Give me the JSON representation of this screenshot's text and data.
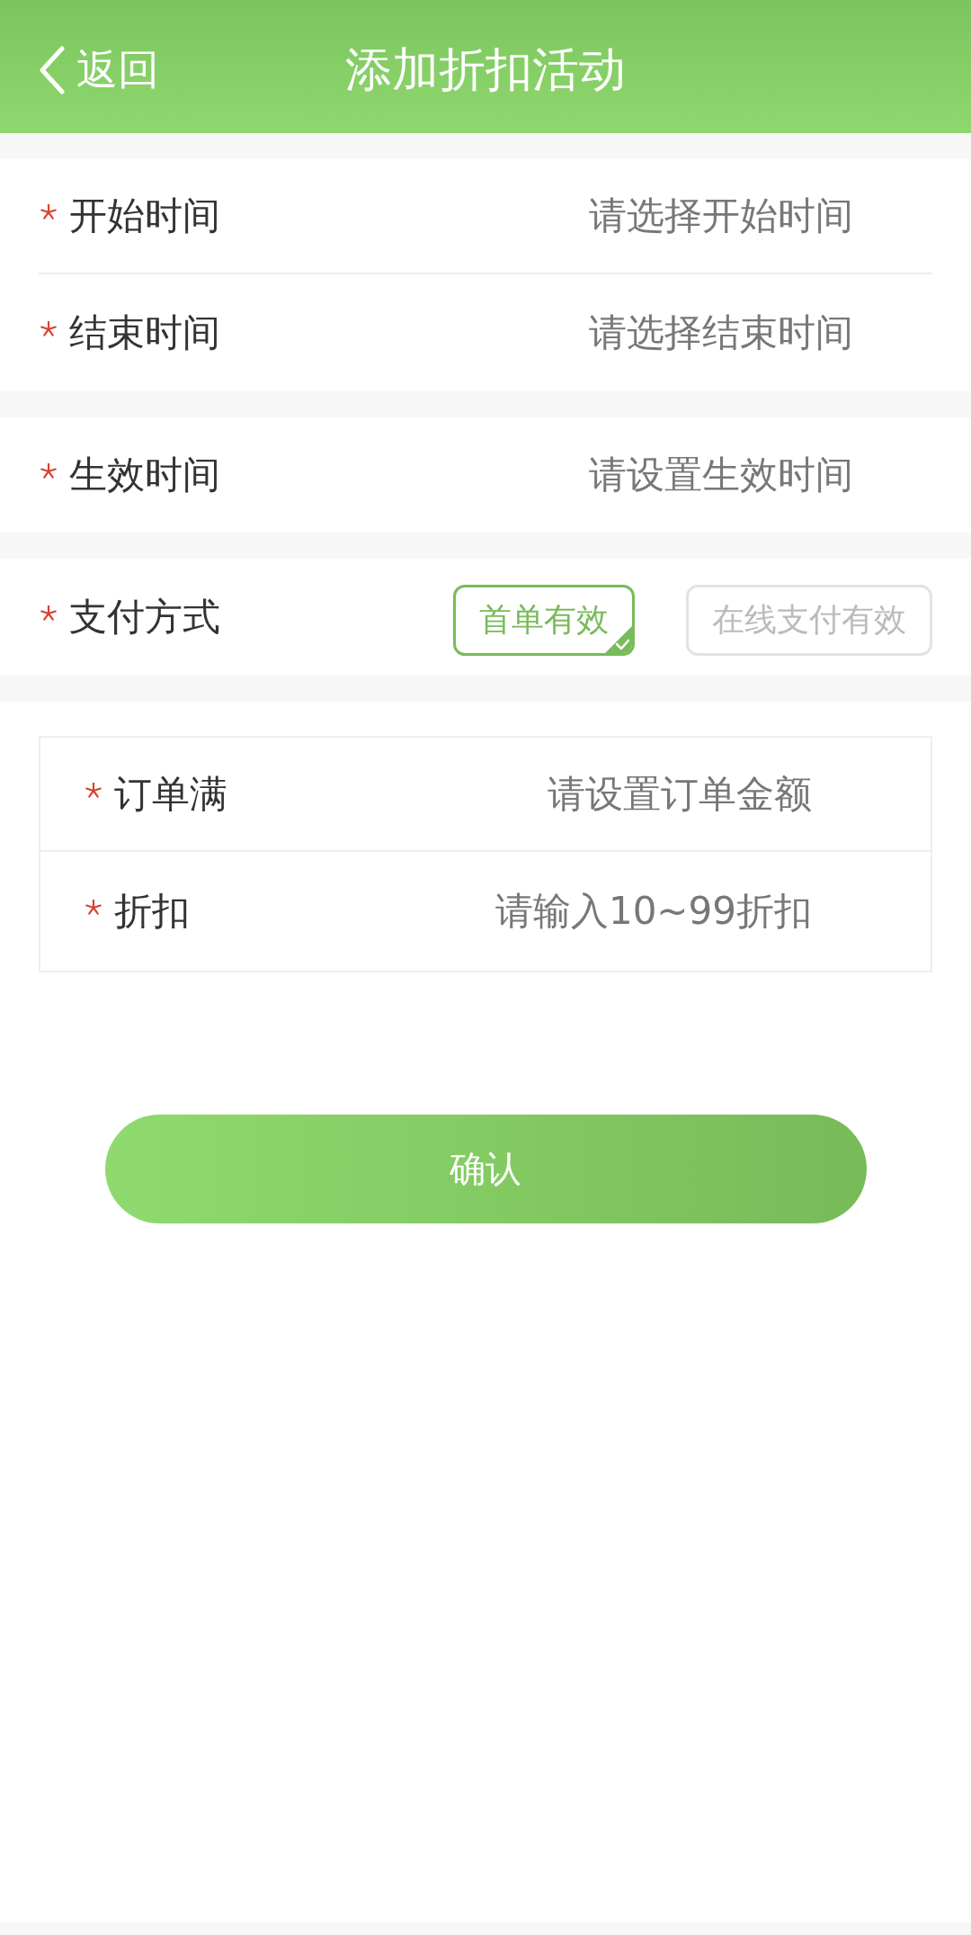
{
  "header": {
    "back_label": "返回",
    "title": "添加折扣活动"
  },
  "sections": [
    {
      "fields": [
        {
          "label": "开始时间",
          "required": true,
          "placeholder": "请选择开始时间"
        },
        {
          "label": "结束时间",
          "required": true,
          "placeholder": "请选择结束时间"
        }
      ]
    },
    {
      "fields": [
        {
          "label": "生效时间",
          "required": true,
          "placeholder": "请设置生效时间"
        }
      ]
    }
  ],
  "payment": {
    "label": "支付方式",
    "required": true,
    "options": [
      {
        "label": "首单有效",
        "selected": true
      },
      {
        "label": "在线支付有效",
        "selected": false
      }
    ]
  },
  "order_rules": {
    "fields": [
      {
        "label": "订单满",
        "required": true,
        "placeholder": "请设置订单金额"
      },
      {
        "label": "折扣",
        "required": true,
        "placeholder": "请输入10~99折扣"
      }
    ]
  },
  "confirm_button": {
    "label": "确认"
  }
}
